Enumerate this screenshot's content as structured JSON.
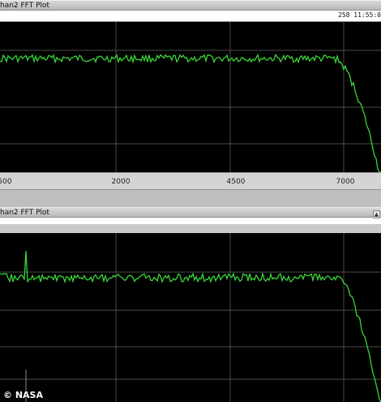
{
  "top_panel": {
    "title": "han2 FFT Plot",
    "timestamp": "258 11:55:0"
  },
  "bottom_panel": {
    "title": "han2 FFT Plot"
  },
  "x_axis": {
    "tick_labels": [
      "500",
      "2000",
      "4500",
      "7000"
    ]
  },
  "colors": {
    "trace": "#39d639",
    "plot_background": "#000000",
    "grid": "#4a4a4a"
  },
  "credit": "© NASA"
}
